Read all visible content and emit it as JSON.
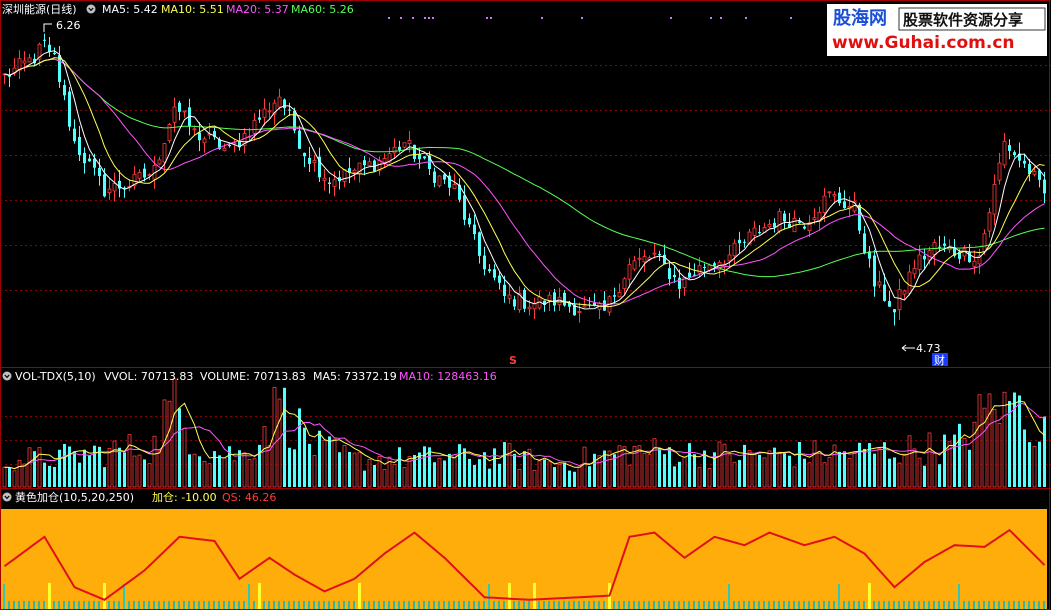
{
  "colors": {
    "background": "#000000",
    "up": "#ff3b3b",
    "down": "#54ffff",
    "ma5": "#ffffff",
    "ma10": "#ffff54",
    "ma20": "#ff54ff",
    "ma60": "#54ff54",
    "grid": "#8b0000",
    "panel_line": "#a00000",
    "indicator_bg": "#ffad0a",
    "qs_line": "#e0101a"
  },
  "main": {
    "title": "深圳能源(日线)",
    "items": [
      {
        "label": "MA5: 5.42",
        "color": "#ffffff"
      },
      {
        "label": "MA10: 5.51",
        "color": "#ffff54"
      },
      {
        "label": "MA20: 5.37",
        "color": "#ff54ff"
      },
      {
        "label": "MA60: 5.26",
        "color": "#54ff54"
      }
    ],
    "high_label": "6.26",
    "low_label": "4.73",
    "marker_s": "S",
    "marker_cai": "财"
  },
  "volume": {
    "title": "VOL-TDX(5,10)",
    "items": [
      {
        "label": "VVOL: 70713.83",
        "color": "#ffffff"
      },
      {
        "label": "VOLUME: 70713.83",
        "color": "#ffffff"
      },
      {
        "label": "MA5: 73372.19",
        "color": "#ffffff"
      },
      {
        "label": "MA10: 128463.16",
        "color": "#ff54ff"
      }
    ]
  },
  "indicator": {
    "title": "黄色加仓(10,5,20,250)",
    "items": [
      {
        "label": "加仓: -10.00",
        "color": "#ffff54"
      },
      {
        "label": "QS: 46.26",
        "color": "#ff3b3b"
      }
    ]
  },
  "watermark": {
    "brand": "股海网",
    "slogan": "股票软件资源分享",
    "url": "www.Guhai.com.cn"
  },
  "chart_data": {
    "type": "candlestick",
    "price_range": [
      4.73,
      6.26
    ],
    "price_anchors": [
      {
        "day": 0,
        "price": 6.05
      },
      {
        "day": 6,
        "price": 6.15
      },
      {
        "day": 9,
        "price": 6.26
      },
      {
        "day": 14,
        "price": 5.7
      },
      {
        "day": 20,
        "price": 5.45
      },
      {
        "day": 25,
        "price": 5.48
      },
      {
        "day": 30,
        "price": 5.55
      },
      {
        "day": 34,
        "price": 5.9
      },
      {
        "day": 38,
        "price": 5.75
      },
      {
        "day": 42,
        "price": 5.7
      },
      {
        "day": 45,
        "price": 5.65
      },
      {
        "day": 50,
        "price": 5.8
      },
      {
        "day": 55,
        "price": 5.95
      },
      {
        "day": 60,
        "price": 5.65
      },
      {
        "day": 65,
        "price": 5.5
      },
      {
        "day": 70,
        "price": 5.55
      },
      {
        "day": 75,
        "price": 5.6
      },
      {
        "day": 80,
        "price": 5.7
      },
      {
        "day": 85,
        "price": 5.55
      },
      {
        "day": 90,
        "price": 5.45
      },
      {
        "day": 95,
        "price": 5.1
      },
      {
        "day": 100,
        "price": 4.88
      },
      {
        "day": 105,
        "price": 4.85
      },
      {
        "day": 110,
        "price": 4.86
      },
      {
        "day": 115,
        "price": 4.82
      },
      {
        "day": 120,
        "price": 4.8
      },
      {
        "day": 125,
        "price": 5.05
      },
      {
        "day": 130,
        "price": 5.1
      },
      {
        "day": 135,
        "price": 4.95
      },
      {
        "day": 140,
        "price": 5.05
      },
      {
        "day": 145,
        "price": 5.1
      },
      {
        "day": 150,
        "price": 5.22
      },
      {
        "day": 155,
        "price": 5.3
      },
      {
        "day": 160,
        "price": 5.28
      },
      {
        "day": 165,
        "price": 5.42
      },
      {
        "day": 170,
        "price": 5.35
      },
      {
        "day": 174,
        "price": 4.95
      },
      {
        "day": 178,
        "price": 4.82
      },
      {
        "day": 182,
        "price": 5.05
      },
      {
        "day": 186,
        "price": 5.15
      },
      {
        "day": 190,
        "price": 5.12
      },
      {
        "day": 195,
        "price": 5.1
      },
      {
        "day": 200,
        "price": 5.7
      },
      {
        "day": 205,
        "price": 5.55
      },
      {
        "day": 208,
        "price": 5.42
      }
    ],
    "volume_anchors": [
      {
        "day": 0,
        "v": 60000
      },
      {
        "day": 10,
        "v": 65000
      },
      {
        "day": 30,
        "v": 90000
      },
      {
        "day": 33,
        "v": 190000
      },
      {
        "day": 40,
        "v": 80000
      },
      {
        "day": 48,
        "v": 70000
      },
      {
        "day": 55,
        "v": 180000
      },
      {
        "day": 62,
        "v": 90000
      },
      {
        "day": 70,
        "v": 60000
      },
      {
        "day": 100,
        "v": 70000
      },
      {
        "day": 110,
        "v": 50000
      },
      {
        "day": 125,
        "v": 80000
      },
      {
        "day": 150,
        "v": 70000
      },
      {
        "day": 170,
        "v": 75000
      },
      {
        "day": 190,
        "v": 90000
      },
      {
        "day": 200,
        "v": 210000
      },
      {
        "day": 208,
        "v": 120000
      }
    ],
    "qs_anchors": [
      {
        "day": 0,
        "v": 45
      },
      {
        "day": 8,
        "v": 80
      },
      {
        "day": 14,
        "v": 20
      },
      {
        "day": 20,
        "v": 5
      },
      {
        "day": 28,
        "v": 40
      },
      {
        "day": 35,
        "v": 80
      },
      {
        "day": 42,
        "v": 75
      },
      {
        "day": 47,
        "v": 30
      },
      {
        "day": 53,
        "v": 55
      },
      {
        "day": 58,
        "v": 35
      },
      {
        "day": 64,
        "v": 15
      },
      {
        "day": 70,
        "v": 30
      },
      {
        "day": 76,
        "v": 60
      },
      {
        "day": 82,
        "v": 85
      },
      {
        "day": 88,
        "v": 55
      },
      {
        "day": 96,
        "v": 8
      },
      {
        "day": 105,
        "v": 5
      },
      {
        "day": 115,
        "v": 8
      },
      {
        "day": 121,
        "v": 10
      },
      {
        "day": 125,
        "v": 80
      },
      {
        "day": 130,
        "v": 85
      },
      {
        "day": 136,
        "v": 55
      },
      {
        "day": 142,
        "v": 80
      },
      {
        "day": 148,
        "v": 70
      },
      {
        "day": 153,
        "v": 85
      },
      {
        "day": 160,
        "v": 70
      },
      {
        "day": 166,
        "v": 80
      },
      {
        "day": 172,
        "v": 60
      },
      {
        "day": 178,
        "v": 20
      },
      {
        "day": 184,
        "v": 50
      },
      {
        "day": 190,
        "v": 70
      },
      {
        "day": 196,
        "v": 68
      },
      {
        "day": 201,
        "v": 88
      },
      {
        "day": 208,
        "v": 46.26
      }
    ],
    "jiacang_days": [
      9,
      20,
      51,
      71,
      101,
      106,
      121,
      173
    ],
    "qs_range": [
      0,
      100
    ],
    "days": 209
  }
}
